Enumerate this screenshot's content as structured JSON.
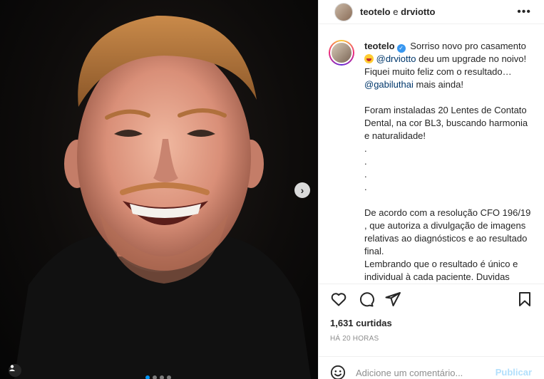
{
  "post": {
    "header": {
      "authors_primary": "teotelo",
      "authors_sep": "e",
      "authors_secondary": "drviotto",
      "more_icon": "more-horizontal-icon"
    },
    "caption": {
      "username": "teotelo",
      "line1": "Sorriso novo pro casamento",
      "mention1": "@drviotto",
      "line2": "deu um upgrade no noivo! Fiquei muito feliz com o resultado…",
      "mention2": "@gabiluthai",
      "line3": "mais ainda!",
      "para2": "Foram instaladas 20 Lentes de Contato Dental, na cor BL3, buscando harmonia e naturalidade!",
      "dot": ".",
      "para3": "De acordo com a resolução CFO 196/19 , que autoriza a divulgação de imagens relativas ao diagnósticos e ao resultado final.",
      "para4": "Lembrando que o resultado é único e individual à cada paciente. Duvidas"
    },
    "likes": "1,631 curtidas",
    "timestamp": "HÁ 20 HORAS",
    "comment": {
      "placeholder": "Adicione um comentário...",
      "publish_label": "Publicar"
    },
    "carousel": {
      "slides": 4,
      "active": 1
    }
  },
  "colors": {
    "accent": "#0095f6",
    "verified": "#3897f0",
    "mention": "#00376b",
    "publish_disabled": "#b2dffc"
  }
}
